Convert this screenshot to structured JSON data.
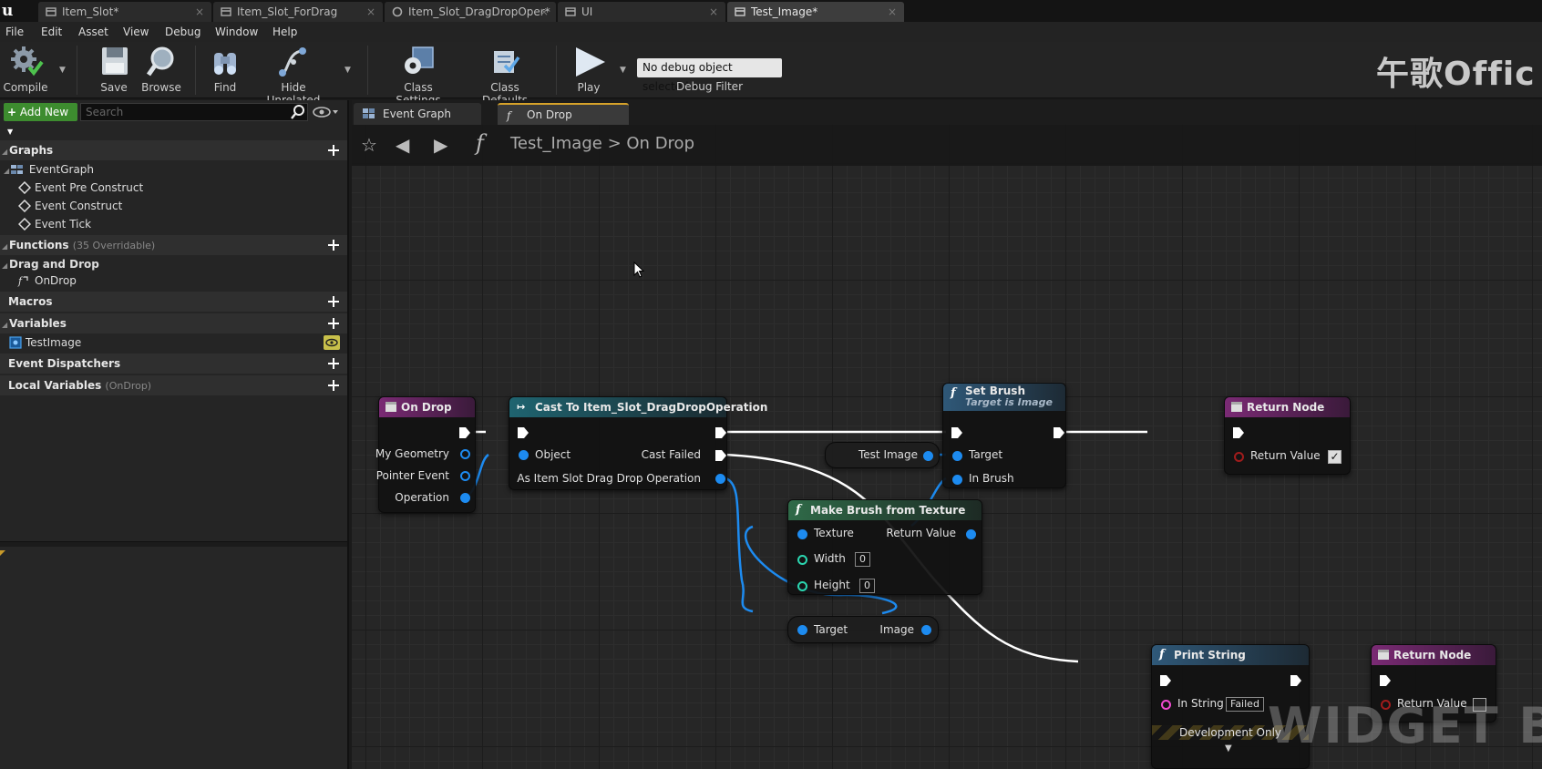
{
  "tabs": [
    {
      "label": "Item_Slot*",
      "active": false
    },
    {
      "label": "Item_Slot_ForDrag",
      "active": false
    },
    {
      "label": "Item_Slot_DragDropOper*",
      "active": false
    },
    {
      "label": "UI",
      "active": false
    },
    {
      "label": "Test_Image*",
      "active": true
    }
  ],
  "menu": [
    "File",
    "Edit",
    "Asset",
    "View",
    "Debug",
    "Window",
    "Help"
  ],
  "toolbar": {
    "compile": "Compile",
    "save": "Save",
    "browse": "Browse",
    "find": "Find",
    "hide_unrelated": "Hide Unrelated",
    "class_settings": "Class Settings",
    "class_defaults": "Class Defaults",
    "play": "Play",
    "debug_select": "No debug object selected",
    "debug_filter": "Debug Filter"
  },
  "watermark_top": "午歌Offic",
  "watermark_bottom": "WIDGET BLU",
  "panel": {
    "add_new": "Add New",
    "search_placeholder": "Search",
    "graphs": "Graphs",
    "event_graph": "EventGraph",
    "events": [
      "Event Pre Construct",
      "Event Construct",
      "Event Tick"
    ],
    "functions": "Functions",
    "functions_sub": "(35 Overridable)",
    "drag_and_drop": "Drag and Drop",
    "on_drop": "OnDrop",
    "macros": "Macros",
    "variables": "Variables",
    "test_image": "TestImage",
    "event_dispatchers": "Event Dispatchers",
    "local_variables": "Local Variables",
    "local_variables_sub": "(OnDrop)"
  },
  "graph_tabs": [
    {
      "label": "Event Graph",
      "active": false
    },
    {
      "label": "On Drop",
      "active": true
    }
  ],
  "breadcrumb": {
    "blueprint": "Test_Image",
    "separator": ">",
    "function": "On Drop"
  },
  "nodes": {
    "on_drop": {
      "title": "On Drop",
      "pins": [
        "My Geometry",
        "Pointer Event",
        "Operation"
      ]
    },
    "cast": {
      "title": "Cast To Item_Slot_DragDropOperation",
      "object": "Object",
      "cast_failed": "Cast Failed",
      "as_output": "As Item Slot Drag Drop Operation"
    },
    "set_brush": {
      "title": "Set Brush",
      "subtitle": "Target is Image",
      "target": "Target",
      "in_brush": "In Brush"
    },
    "test_image_var": {
      "label": "Test Image"
    },
    "make_brush": {
      "title": "Make Brush from Texture",
      "texture": "Texture",
      "return_value": "Return Value",
      "width": "Width",
      "width_value": "0",
      "height": "Height",
      "height_value": "0"
    },
    "image_getter": {
      "target": "Target",
      "image": "Image"
    },
    "return_top": {
      "title": "Return Node",
      "return_value": "Return Value",
      "checked": true
    },
    "print_string": {
      "title": "Print String",
      "in_string": "In String",
      "in_string_value": "Failed",
      "dev_only": "Development Only"
    },
    "return_bottom": {
      "title": "Return Node",
      "return_value": "Return Value",
      "checked": false
    }
  },
  "colors": {
    "exec": "#ffffff",
    "object_pin": "#1d8bf0",
    "int_pin": "#2bd6b0",
    "string_pin": "#f04ad0",
    "bool_pin": "#a01c1c",
    "add_new": "#3d8c2f",
    "active_tab_accent": "#d6a22a"
  },
  "icons": [
    "compile-gear-icon",
    "save-disk-icon",
    "browse-magnifier-icon",
    "find-binoculars-icon",
    "hide-unrelated-icon",
    "class-settings-icon",
    "class-defaults-icon",
    "play-icon",
    "search-icon",
    "eye-icon",
    "plus-icon",
    "function-icon",
    "star-icon",
    "back-arrow-icon",
    "forward-arrow-icon"
  ]
}
